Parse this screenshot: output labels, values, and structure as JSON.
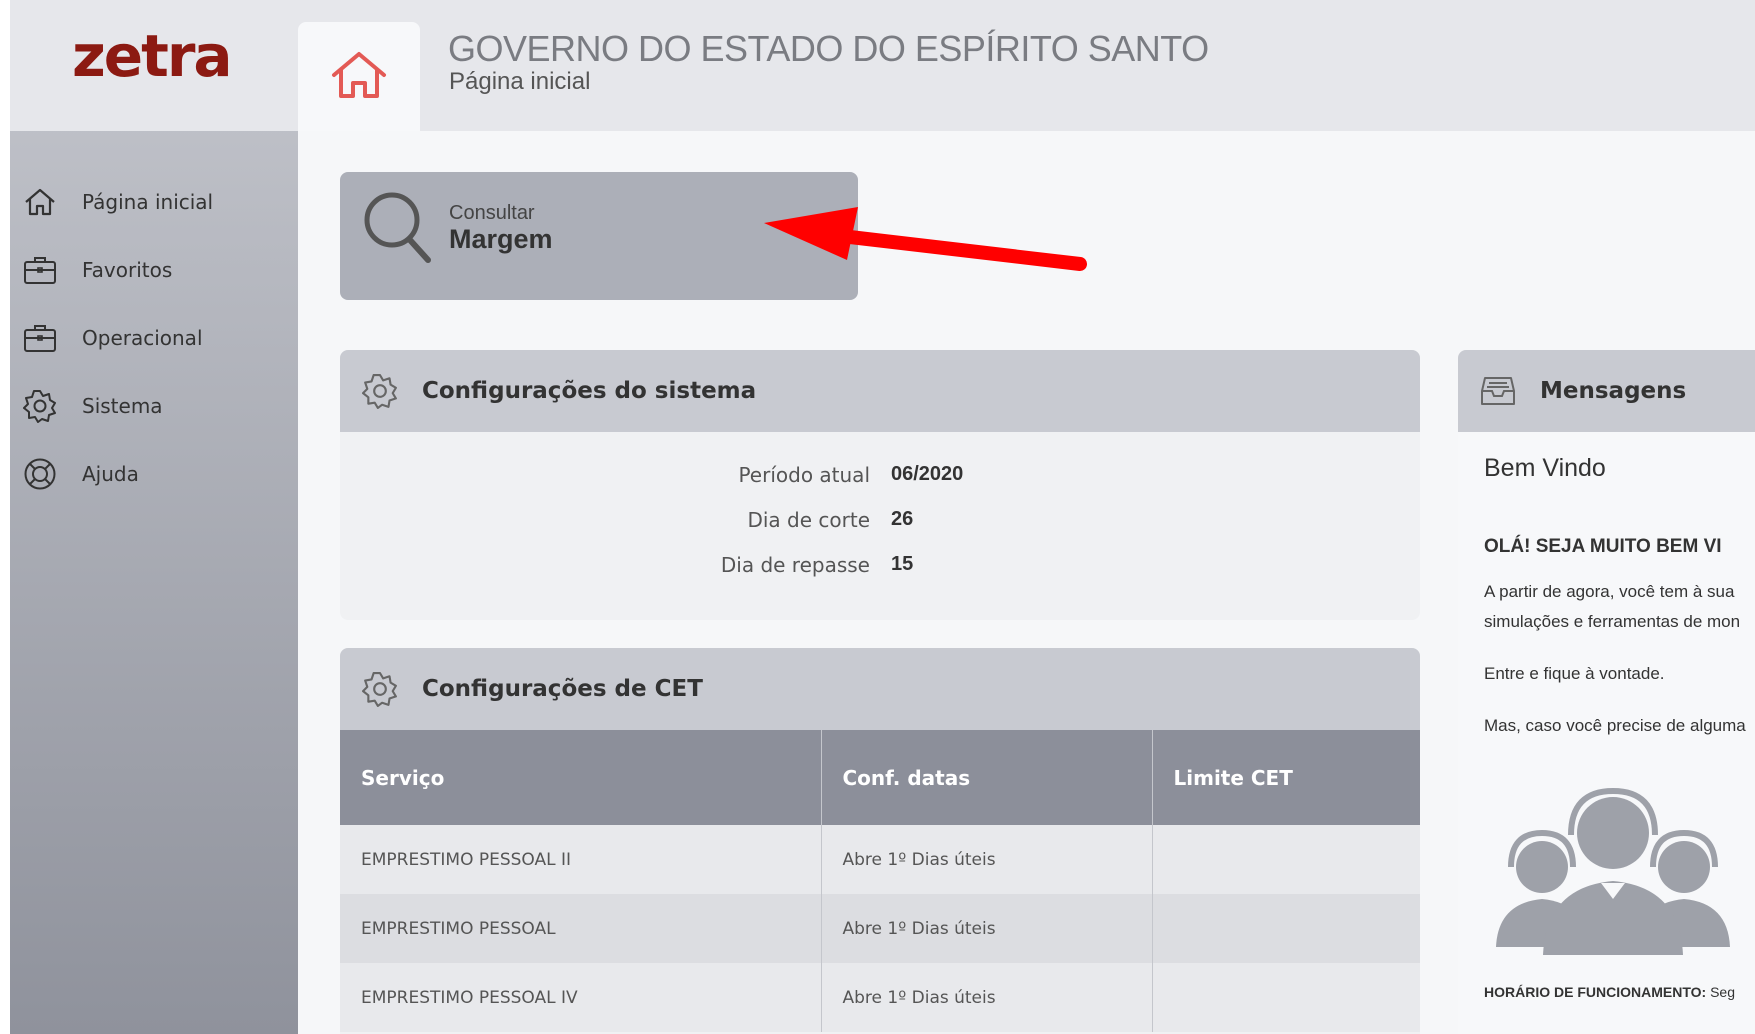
{
  "logo": {
    "text": "zetra"
  },
  "header": {
    "title": "GOVERNO DO ESTADO DO ESPÍRITO SANTO",
    "subtitle": "Página inicial"
  },
  "sidebar": {
    "items": [
      {
        "label": "Página inicial",
        "icon": "home-icon"
      },
      {
        "label": "Favoritos",
        "icon": "briefcase-icon"
      },
      {
        "label": "Operacional",
        "icon": "briefcase-icon"
      },
      {
        "label": "Sistema",
        "icon": "gear-icon"
      },
      {
        "label": "Ajuda",
        "icon": "lifebuoy-icon"
      }
    ]
  },
  "quick_action": {
    "line1": "Consultar",
    "line2": "Margem",
    "icon": "search-icon"
  },
  "system_config": {
    "title": "Configurações do sistema",
    "rows": [
      {
        "label": "Período atual",
        "value": "06/2020"
      },
      {
        "label": "Dia de corte",
        "value": "26"
      },
      {
        "label": "Dia de repasse",
        "value": "15"
      }
    ]
  },
  "cet_config": {
    "title": "Configurações de CET",
    "columns": [
      "Serviço",
      "Conf. datas",
      "Limite CET"
    ],
    "rows": [
      {
        "servico": "EMPRESTIMO PESSOAL II",
        "datas": "Abre 1º Dias úteis",
        "limite": ""
      },
      {
        "servico": "EMPRESTIMO PESSOAL",
        "datas": "Abre 1º Dias úteis",
        "limite": ""
      },
      {
        "servico": "EMPRESTIMO PESSOAL IV",
        "datas": "Abre 1º Dias úteis",
        "limite": ""
      }
    ]
  },
  "messages": {
    "title": "Mensagens",
    "greeting": "Bem Vindo",
    "heading": "OLÁ! SEJA MUITO BEM VI",
    "paragraph_line1": "A partir de agora, você tem à sua",
    "paragraph_line2": "simulações e ferramentas de mon",
    "paragraph2": "Entre e fique à vontade.",
    "paragraph3": "Mas, caso você precise de alguma",
    "footer_label": "HORÁRIO DE FUNCIONAMENTO:",
    "footer_value": "Seg"
  },
  "colors": {
    "logo": "#8c1a12",
    "home_icon": "#e35a55",
    "annotation_arrow": "#ff0000",
    "table_header": "#8c8f9a"
  }
}
